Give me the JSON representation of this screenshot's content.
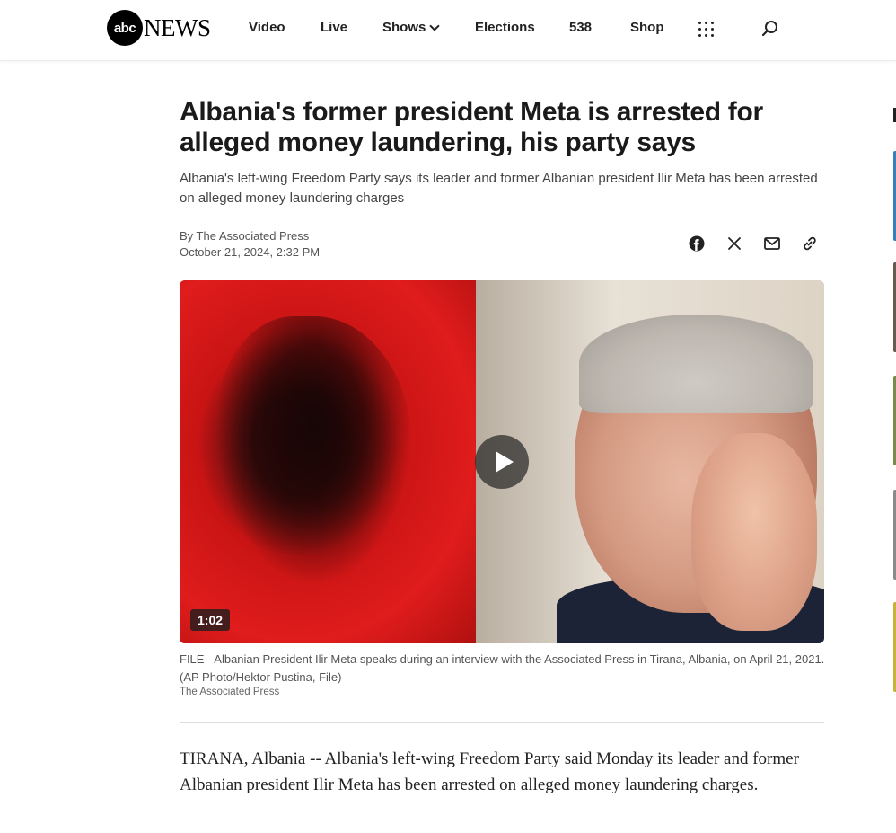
{
  "header": {
    "logo_ball": "abc",
    "logo_news": "NEWS",
    "nav": [
      {
        "label": "Video"
      },
      {
        "label": "Live"
      },
      {
        "label": "Shows"
      },
      {
        "label": "Elections"
      },
      {
        "label": "538"
      },
      {
        "label": "Shop"
      }
    ],
    "menu_icon": "grid-menu-icon",
    "search_icon": "search-icon"
  },
  "article": {
    "headline": "Albania's former president Meta is arrested for alleged money laundering, his party says",
    "dek": "Albania's left-wing Freedom Party says its leader and former Albanian president Ilir Meta has been arrested on alleged money laundering charges",
    "byline": "By The Associated Press",
    "date": "October 21, 2024, 2:32 PM",
    "share_icons": [
      "facebook-icon",
      "x-icon",
      "email-icon",
      "link-icon"
    ],
    "video": {
      "duration": "1:02"
    },
    "caption": "FILE - Albanian President Ilir Meta speaks during an interview with the Associated Press in Tirana, Albania, on April 21, 2021. (AP Photo/Hektor Pustina, File)",
    "credit": "The Associated Press",
    "body": "TIRANA, Albania -- Albania's left-wing Freedom Party said Monday its leader and former Albanian president Ilir Meta has been arrested on alleged money laundering charges."
  }
}
